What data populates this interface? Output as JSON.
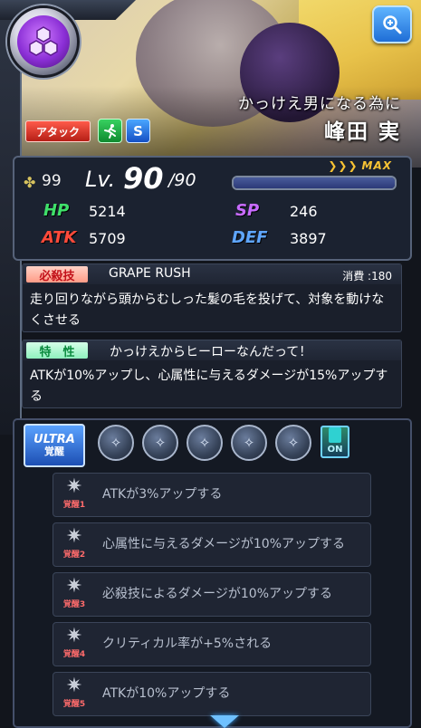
{
  "character": {
    "title": "かっけえ男になる為に",
    "name": "峰田 実",
    "tags": {
      "attack": "アタック",
      "rarity": "S"
    }
  },
  "status": {
    "luck": "99",
    "lv_label": "Lv.",
    "level": "90",
    "level_max": "/90",
    "max_label": "MAX",
    "exp_fill": 1.0,
    "hp_label": "HP",
    "hp": "5214",
    "sp_label": "SP",
    "sp": "246",
    "atk_label": "ATK",
    "atk": "5709",
    "def_label": "DEF",
    "def": "3897"
  },
  "special_move": {
    "tag": "必殺技",
    "name": "GRAPE RUSH",
    "cost": "消費 :180",
    "description": "走り回りながら頭からむしった髪の毛を投げて、対象を動けなくさせる"
  },
  "ability": {
    "tag": "特　性",
    "name": "かっけえからヒーローなんだって！",
    "description": "ATKが10%アップし、心属性に与えるダメージが15%アップする"
  },
  "ultra": {
    "tag_line1": "ULTRA",
    "tag_line2": "覚醒",
    "toggle_label": "ON",
    "awakenings": [
      {
        "num": "覚醒1",
        "text": "ATKが3%アップする"
      },
      {
        "num": "覚醒2",
        "text": "心属性に与えるダメージが10%アップする"
      },
      {
        "num": "覚醒3",
        "text": "必殺技によるダメージが10%アップする"
      },
      {
        "num": "覚醒4",
        "text": "クリティカル率が+5%される"
      },
      {
        "num": "覚醒5",
        "text": "ATKが10%アップする"
      }
    ]
  },
  "colors": {
    "hp": "#3fe06a",
    "atk": "#ff4a3a",
    "sp": "#c86bff",
    "def": "#5fa6ff",
    "accent": "#f6c234"
  },
  "icons": [
    "element-tech-icon",
    "zoom-icon",
    "speed-runner-icon",
    "clover-icon",
    "awakening-orb-icon",
    "card-toggle-icon",
    "scroll-down-icon"
  ]
}
